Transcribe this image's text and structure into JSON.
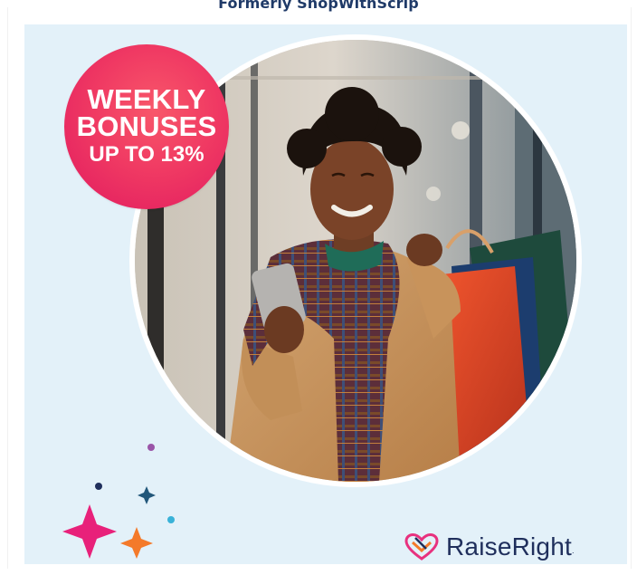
{
  "header": {
    "caption": "Formerly ShopWithScrip"
  },
  "badge": {
    "line1": "WEEKLY",
    "line2": "BONUSES",
    "line3": "UP TO 13%"
  },
  "logo": {
    "brand": "RaiseRight",
    "tm": "."
  },
  "colors": {
    "panel_bg": "#e3f1f9",
    "badge_pink": "#f03a63",
    "logo_navy": "#1f2f5c",
    "star_pink": "#e8217a",
    "star_orange": "#f47a2a",
    "star_navy": "#22577a"
  },
  "icons": [
    "raiseright-heart-logo-icon",
    "sparkle-star-icon"
  ]
}
